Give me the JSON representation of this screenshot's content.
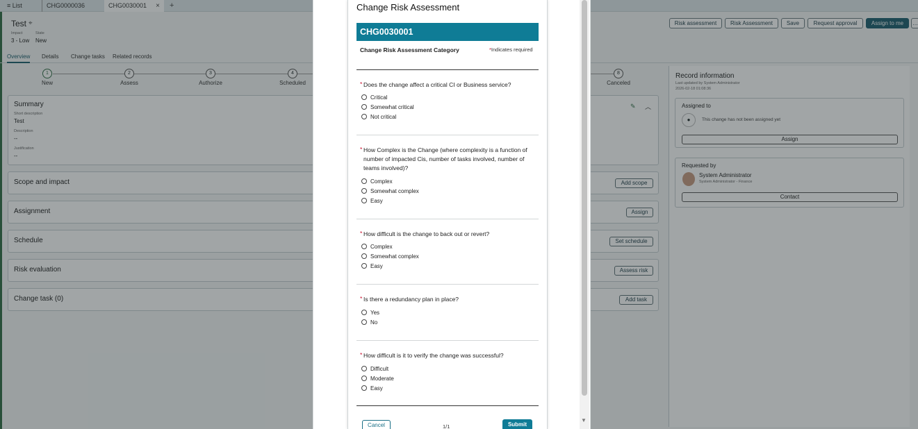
{
  "tabs": [
    {
      "label": "≡ List"
    },
    {
      "label": "CHG0000036"
    },
    {
      "label": "CHG0030001"
    }
  ],
  "record": {
    "title": "Test",
    "impact_label": "Impact",
    "impact_value": "3 - Low",
    "state_label": "State",
    "state_value": "New"
  },
  "header_buttons": [
    "Risk assessment",
    "Risk Assessment",
    "Save",
    "Request approval",
    "Assign to me"
  ],
  "subtabs": [
    "Overview",
    "Details",
    "Change tasks",
    "Related records"
  ],
  "steps": [
    {
      "num": "1",
      "label": "New"
    },
    {
      "num": "2",
      "label": "Assess"
    },
    {
      "num": "3",
      "label": "Authorize"
    },
    {
      "num": "4",
      "label": "Scheduled"
    },
    {
      "num": "8",
      "label": "Canceled"
    }
  ],
  "summary": {
    "title": "Summary",
    "short_desc_label": "Short description",
    "short_desc_value": "Test",
    "desc_label": "Description",
    "desc_value": "--",
    "just_label": "Justification",
    "just_value": "--"
  },
  "sections": [
    {
      "title": "Scope and impact",
      "button": "Add scope"
    },
    {
      "title": "Assignment",
      "button": "Assign"
    },
    {
      "title": "Schedule",
      "button": "Set schedule"
    },
    {
      "title": "Risk evaluation",
      "button": "Assess risk"
    },
    {
      "title": "Change task (0)",
      "button": "Add task"
    }
  ],
  "record_info": {
    "title": "Record information",
    "updated_by": "Last updated by System Administrator",
    "updated_at": "2026-02-18 01:08:36",
    "assigned_title": "Assigned to",
    "assigned_text": "This change has not been assigned yet",
    "assign_button": "Assign",
    "requested_title": "Requested by",
    "requester_name": "System Administrator",
    "requester_sub": "System Administrator - Finance",
    "contact_button": "Contact"
  },
  "modal": {
    "title": "Change Risk Assessment",
    "banner": "CHG0030001",
    "category": "Change Risk Assessment Category",
    "required_note": "Indicates required",
    "required_star": "*",
    "questions": [
      {
        "text": "Does the change affect a critical CI or Business service?",
        "options": [
          "Critical",
          "Somewhat critical",
          "Not critical"
        ]
      },
      {
        "text": "How Complex is the Change (where complexity is a function of number of impacted Cis, number of tasks involved, number of teams involved)?",
        "options": [
          "Complex",
          "Somewhat complex",
          "Easy"
        ]
      },
      {
        "text": "How difficult is the change to back out or revert?",
        "options": [
          "Complex",
          "Somewhat complex",
          "Easy"
        ]
      },
      {
        "text": "Is there a redundancy plan in place?",
        "options": [
          "Yes",
          "No"
        ]
      },
      {
        "text": "How difficult is it to verify the change was successful?",
        "options": [
          "Difficult",
          "Moderate",
          "Easy"
        ]
      }
    ],
    "cancel": "Cancel",
    "page_indicator": "1/1",
    "submit": "Submit"
  },
  "colors": {
    "accent": "#0f7c96",
    "primary_button": "#1c5e6e",
    "required": "#c8102e"
  }
}
